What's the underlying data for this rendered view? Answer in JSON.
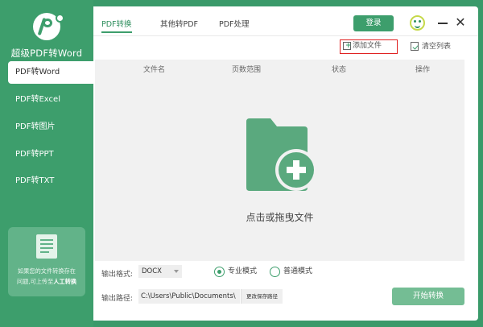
{
  "brand": {
    "title": "超级PDF转Word",
    "logo": "pdf-brand-logo"
  },
  "sidebar": {
    "items": [
      {
        "label": "PDF转Word",
        "active": true
      },
      {
        "label": "PDF转Excel",
        "active": false
      },
      {
        "label": "PDF转图片",
        "active": false
      },
      {
        "label": "PDF转PPT",
        "active": false
      },
      {
        "label": "PDF转TXT",
        "active": false
      }
    ],
    "help": {
      "line1": "如果您的文件转换存在",
      "line2_prefix": "问题,可上传至",
      "line2_link": "人工转换"
    }
  },
  "header": {
    "tabs": [
      {
        "label": "PDF转换",
        "active": true
      },
      {
        "label": "其他转PDF",
        "active": false
      },
      {
        "label": "PDF处理",
        "active": false
      }
    ],
    "login_label": "登录",
    "icons": {
      "mascot": "mascot-icon",
      "minimize": "minimize-icon",
      "close": "close-icon",
      "close_glyph": "✕"
    }
  },
  "toolbar": {
    "add_file_label": "添加文件",
    "clear_list_label": "清空列表"
  },
  "table": {
    "columns": [
      "文件名",
      "页数范围",
      "状态",
      "操作"
    ],
    "rows": [],
    "drop_hint": "点击或拖曳文件"
  },
  "settings": {
    "format_label": "输出格式:",
    "format_value": "DOCX",
    "modes": [
      {
        "label": "专业模式",
        "checked": true
      },
      {
        "label": "普通模式",
        "checked": false
      }
    ],
    "path_label": "输出路径:",
    "path_value": "C:\\Users\\Public\\Documents\\",
    "change_path_label": "更改保存路径",
    "start_label": "开始转换"
  },
  "colors": {
    "brand_green": "#3d9e6c",
    "highlight_red": "#e02020",
    "start_button": "#74bd94"
  }
}
